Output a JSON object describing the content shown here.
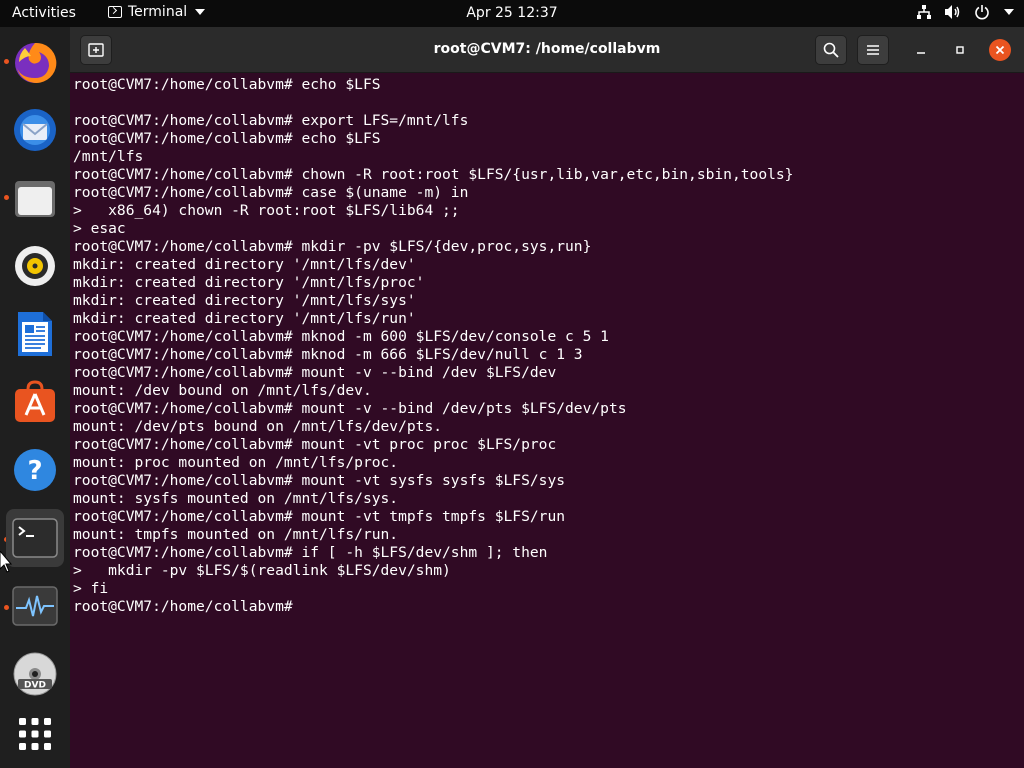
{
  "topbar": {
    "activities": "Activities",
    "app_name": "Terminal",
    "clock": "Apr 25  12:37"
  },
  "dock": {
    "items": [
      {
        "name": "firefox",
        "running": true
      },
      {
        "name": "thunderbird",
        "running": false
      },
      {
        "name": "files",
        "running": true
      },
      {
        "name": "rhythmbox",
        "running": false
      },
      {
        "name": "libreoffice-writer",
        "running": false
      },
      {
        "name": "ubuntu-software",
        "running": false
      },
      {
        "name": "help",
        "running": false
      },
      {
        "name": "terminal",
        "running": true,
        "active": true
      },
      {
        "name": "system-monitor",
        "running": true
      },
      {
        "name": "dvd",
        "running": false
      },
      {
        "name": "show-applications",
        "running": false
      }
    ]
  },
  "window": {
    "title": "root@CVM7: /home/collabvm"
  },
  "terminal": {
    "lines": [
      "root@CVM7:/home/collabvm# echo $LFS",
      "",
      "root@CVM7:/home/collabvm# export LFS=/mnt/lfs",
      "root@CVM7:/home/collabvm# echo $LFS",
      "/mnt/lfs",
      "root@CVM7:/home/collabvm# chown -R root:root $LFS/{usr,lib,var,etc,bin,sbin,tools}",
      "root@CVM7:/home/collabvm# case $(uname -m) in",
      ">   x86_64) chown -R root:root $LFS/lib64 ;;",
      "> esac",
      "root@CVM7:/home/collabvm# mkdir -pv $LFS/{dev,proc,sys,run}",
      "mkdir: created directory '/mnt/lfs/dev'",
      "mkdir: created directory '/mnt/lfs/proc'",
      "mkdir: created directory '/mnt/lfs/sys'",
      "mkdir: created directory '/mnt/lfs/run'",
      "root@CVM7:/home/collabvm# mknod -m 600 $LFS/dev/console c 5 1",
      "root@CVM7:/home/collabvm# mknod -m 666 $LFS/dev/null c 1 3",
      "root@CVM7:/home/collabvm# mount -v --bind /dev $LFS/dev",
      "mount: /dev bound on /mnt/lfs/dev.",
      "root@CVM7:/home/collabvm# mount -v --bind /dev/pts $LFS/dev/pts",
      "mount: /dev/pts bound on /mnt/lfs/dev/pts.",
      "root@CVM7:/home/collabvm# mount -vt proc proc $LFS/proc",
      "mount: proc mounted on /mnt/lfs/proc.",
      "root@CVM7:/home/collabvm# mount -vt sysfs sysfs $LFS/sys",
      "mount: sysfs mounted on /mnt/lfs/sys.",
      "root@CVM7:/home/collabvm# mount -vt tmpfs tmpfs $LFS/run",
      "mount: tmpfs mounted on /mnt/lfs/run.",
      "root@CVM7:/home/collabvm# if [ -h $LFS/dev/shm ]; then",
      ">   mkdir -pv $LFS/$(readlink $LFS/dev/shm)",
      "> fi",
      "root@CVM7:/home/collabvm# "
    ]
  },
  "colors": {
    "terminal_bg": "#300a24",
    "accent": "#e95420",
    "topbar_bg": "#0b0b0b",
    "dock_bg": "#1f1f1f"
  }
}
